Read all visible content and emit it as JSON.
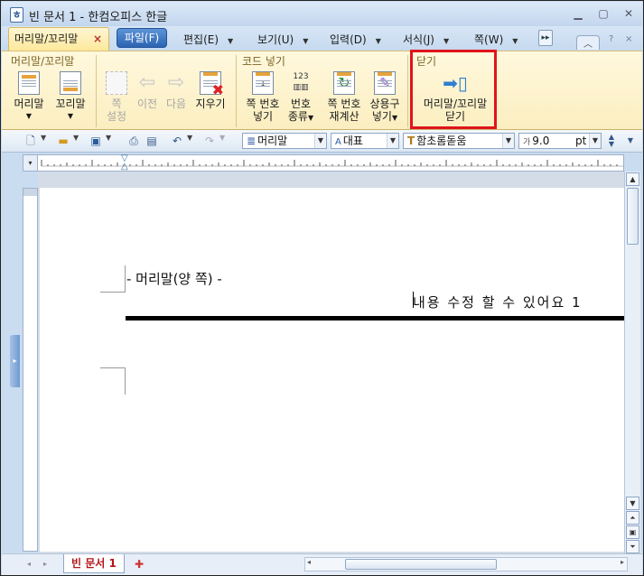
{
  "window": {
    "title": "빈 문서 1 - 한컴오피스 한글",
    "app_icon": "hwp-icon"
  },
  "tabs": {
    "context_tab": "머리말/꼬리말",
    "context_close": "×",
    "file_tab": "파일(F)",
    "menus": [
      "편집(E)",
      "보기(U)",
      "입력(D)",
      "서식(J)",
      "쪽(W)"
    ]
  },
  "ribbon": {
    "groups": [
      "머리말/꼬리말",
      "코드 넣기",
      "닫기"
    ],
    "buttons": {
      "header": "머리말",
      "footer": "꼬리말",
      "page_set_1": "쪽",
      "page_set_2": "설정",
      "prev": "이전",
      "next": "다음",
      "erase": "지우기",
      "insert_page_no_1": "쪽 번호",
      "insert_page_no_2": "넣기",
      "number_type_1": "번호",
      "number_type_2": "종류",
      "renumber_1": "쪽 번호",
      "renumber_2": "재계산",
      "common_phrase_1": "상용구",
      "common_phrase_2": "넣기",
      "close_1": "머리말/꼬리말",
      "close_2": "닫기"
    }
  },
  "toolbar": {
    "style": "머리말",
    "lang": "대표",
    "font": "함초롬돋움",
    "size": "9.0",
    "unit": "pt"
  },
  "document": {
    "header_label": "- 머리말(양 쪽) -",
    "header_text": "내용 수정 할 수 있어요 1"
  },
  "status": {
    "doc_tab": "빈 문서 1"
  },
  "colors": {
    "highlight": "#e0141b",
    "ribbon_bg": "#fbeec0"
  }
}
